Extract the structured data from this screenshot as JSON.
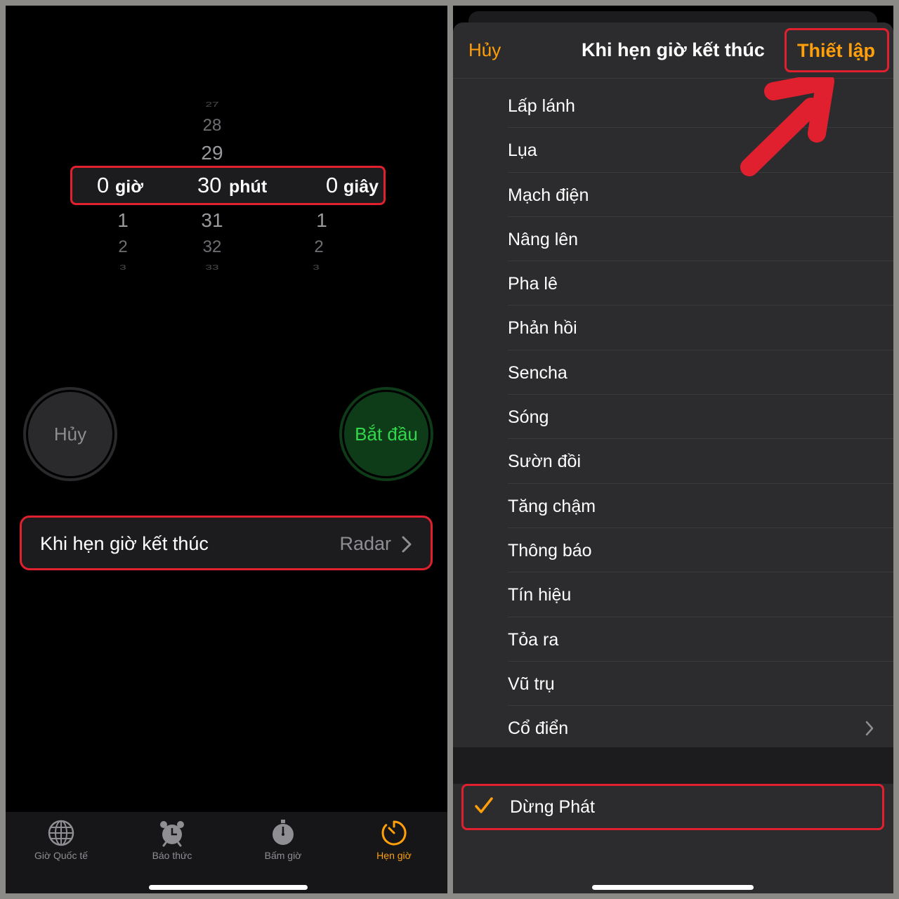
{
  "left": {
    "picker": {
      "hours": {
        "above": [],
        "selected": "0",
        "unit": "giờ",
        "below": [
          "1",
          "2",
          "3"
        ]
      },
      "minutes": {
        "above": [
          "27",
          "28",
          "29"
        ],
        "selected": "30",
        "unit": "phút",
        "below": [
          "31",
          "32",
          "33"
        ]
      },
      "seconds": {
        "above": [],
        "selected": "0",
        "unit": "giây",
        "below": [
          "1",
          "2",
          "3"
        ]
      }
    },
    "cancel_label": "Hủy",
    "start_label": "Bắt đầu",
    "timer_end": {
      "label": "Khi hẹn giờ kết thúc",
      "value": "Radar"
    },
    "tabs": [
      {
        "label": "Giờ Quốc tế",
        "icon": "globe-icon",
        "active": false
      },
      {
        "label": "Báo thức",
        "icon": "alarm-clock-icon",
        "active": false
      },
      {
        "label": "Bấm giờ",
        "icon": "stopwatch-icon",
        "active": false
      },
      {
        "label": "Hẹn giờ",
        "icon": "timer-icon",
        "active": true
      }
    ]
  },
  "right": {
    "nav": {
      "cancel": "Hủy",
      "title": "Khi hẹn giờ kết thúc",
      "set": "Thiết lập"
    },
    "sounds": [
      "Lấp lánh",
      "Lụa",
      "Mạch điện",
      "Nâng lên",
      "Pha lê",
      "Phản hồi",
      "Sencha",
      "Sóng",
      "Sườn đồi",
      "Tăng chậm",
      "Thông báo",
      "Tín hiệu",
      "Tỏa ra",
      "Vũ trụ",
      "Cổ điển"
    ],
    "stop_playing": "Dừng Phát"
  },
  "colors": {
    "accent": "#ff9f0a",
    "highlight": "#e0202e",
    "start_green": "#32d74b"
  }
}
